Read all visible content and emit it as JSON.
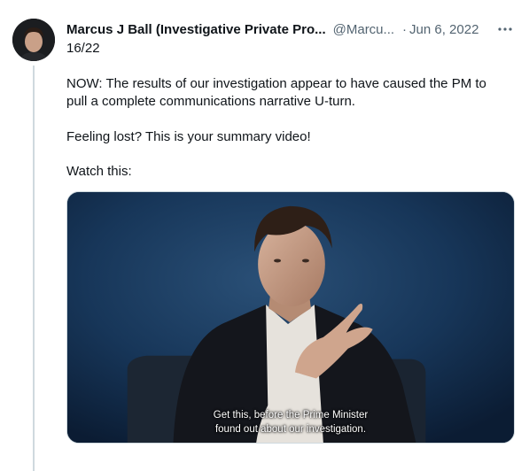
{
  "tweet": {
    "author_name": "Marcus J Ball (Investigative Private Pro...",
    "handle": "@Marcu...",
    "separator": "·",
    "date": "Jun 6, 2022",
    "more_icon": "more-horizontal-icon",
    "thread_counter": "16/22",
    "paragraphs": [
      "NOW: The results of our investigation appear to have caused the PM to pull a complete communications narrative U-turn.",
      "Feeling lost? This is your summary video!",
      "Watch this:"
    ],
    "video": {
      "subtitle_line1": "Get this, before the Prime Minister",
      "subtitle_line2": "found out about our investigation."
    }
  },
  "colors": {
    "text_primary": "#0f1419",
    "text_secondary": "#536471",
    "border": "#cfd9de",
    "video_background": "#0f2540"
  }
}
